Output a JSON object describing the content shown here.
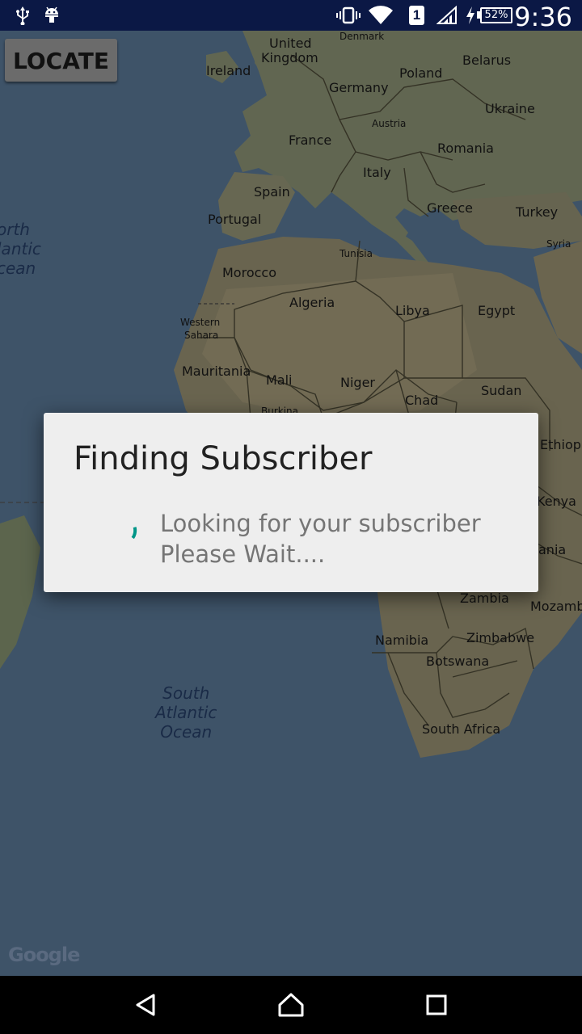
{
  "status_bar": {
    "time": "9:36",
    "battery": "52%",
    "sim": "1",
    "icons": [
      "usb-icon",
      "android-debug-icon",
      "vibrate-icon",
      "wifi-icon",
      "sim-icon",
      "signal-icon",
      "charging-icon",
      "battery-icon"
    ]
  },
  "locate_button": {
    "label": "LOCATE"
  },
  "map": {
    "labels": [
      {
        "name": "label-denmark",
        "text": "Denmark"
      },
      {
        "name": "label-united",
        "text": "United"
      },
      {
        "name": "label-kingdom",
        "text": "Kingdom"
      },
      {
        "name": "label-ireland",
        "text": "Ireland"
      },
      {
        "name": "label-belarus",
        "text": "Belarus"
      },
      {
        "name": "label-poland",
        "text": "Poland"
      },
      {
        "name": "label-germany",
        "text": "Germany"
      },
      {
        "name": "label-ukraine",
        "text": "Ukraine"
      },
      {
        "name": "label-austria",
        "text": "Austria"
      },
      {
        "name": "label-france",
        "text": "France"
      },
      {
        "name": "label-romania",
        "text": "Romania"
      },
      {
        "name": "label-italy",
        "text": "Italy"
      },
      {
        "name": "label-spain",
        "text": "Spain"
      },
      {
        "name": "label-greece",
        "text": "Greece"
      },
      {
        "name": "label-portugal",
        "text": "Portugal"
      },
      {
        "name": "label-turkey",
        "text": "Turkey"
      },
      {
        "name": "label-syria",
        "text": "Syria"
      },
      {
        "name": "label-tunisia",
        "text": "Tunisia"
      },
      {
        "name": "label-morocco",
        "text": "Morocco"
      },
      {
        "name": "label-algeria",
        "text": "Algeria"
      },
      {
        "name": "label-libya",
        "text": "Libya"
      },
      {
        "name": "label-egypt",
        "text": "Egypt"
      },
      {
        "name": "label-western",
        "text": "Western"
      },
      {
        "name": "label-sahara",
        "text": "Sahara"
      },
      {
        "name": "label-mauritania",
        "text": "Mauritania"
      },
      {
        "name": "label-mali",
        "text": "Mali"
      },
      {
        "name": "label-niger",
        "text": "Niger"
      },
      {
        "name": "label-chad",
        "text": "Chad"
      },
      {
        "name": "label-sudan",
        "text": "Sudan"
      },
      {
        "name": "label-burkina",
        "text": "Burkina"
      },
      {
        "name": "label-ethiopia",
        "text": "Ethiopi"
      },
      {
        "name": "label-kenya",
        "text": "Kenya"
      },
      {
        "name": "label-tanzania",
        "text": "ania"
      },
      {
        "name": "label-zambia",
        "text": "Zambia"
      },
      {
        "name": "label-mozambique",
        "text": "Mozamb"
      },
      {
        "name": "label-namibia",
        "text": "Namibia"
      },
      {
        "name": "label-zimbabwe",
        "text": "Zimbabwe"
      },
      {
        "name": "label-botswana",
        "text": "Botswana"
      },
      {
        "name": "label-south-africa",
        "text": "South Africa"
      }
    ],
    "north_atlantic": [
      "orth",
      "lantic",
      "cean"
    ],
    "south_atlantic": [
      "South",
      "Atlantic",
      "Ocean"
    ],
    "attribution": "Google"
  },
  "dialog": {
    "title": "Finding Subscriber",
    "message_line1": "Looking for your subscriber",
    "message_line2": "Please Wait...."
  },
  "colors": {
    "status_bar": "#0b1845",
    "spinner": "#009688",
    "dialog_bg": "#eeeeee"
  }
}
